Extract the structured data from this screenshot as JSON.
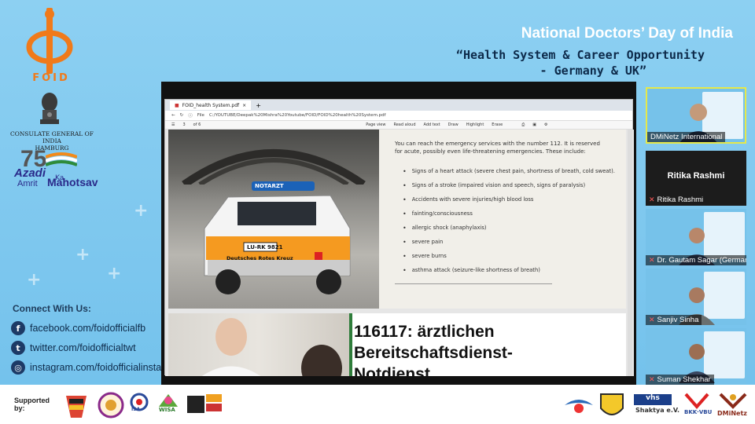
{
  "brand": {
    "foid_text": "FOID",
    "consulate_line1": "CONSULATE GENERAL OF INDIA",
    "consulate_line2": "HAMBURG",
    "azadi_num": "75",
    "azadi_word": "Azadi",
    "azadi_ka": "Ka",
    "azadi_amrit": "Amrit",
    "azadi_mahotsav": "Mahotsav"
  },
  "header": {
    "title": "National Doctors’ Day of India",
    "subtitle_line1": "“Health System & Career Opportunity",
    "subtitle_line2": "- Germany & UK”"
  },
  "connect": {
    "title": "Connect With Us:",
    "links": [
      {
        "icon": "facebook-icon",
        "text": "facebook.com/foidofficialfb"
      },
      {
        "icon": "twitter-icon",
        "text": "twitter.com/foidofficialtwt"
      },
      {
        "icon": "instagram-icon",
        "text": "instagram.com/foidofficialinsta"
      }
    ]
  },
  "browser": {
    "tab_label": "FOID_health System.pdf",
    "address": "C:/YOUTUBE/Deepak%20Mishra%20Youtube/FOID/FOID%20health%20System.pdf",
    "file_label": "File",
    "page_num": "3",
    "page_total": "of 6",
    "toolbar": [
      "Page view",
      "Read aloud",
      "Add text",
      "Draw",
      "Highlight",
      "Erase"
    ]
  },
  "pdf": {
    "ambulance_sign": "NOTARZT",
    "plate": "LU-RK 9821",
    "drk": "Deutsches Rotes Kreuz",
    "intro": "You can reach the emergency services with the number 112. It is reserved for acute, possibly even life-threatening emergencies. These include:",
    "items": [
      "Signs of a heart attack (severe chest pain, shortness of breath, cold sweat).",
      "Signs of a stroke (impaired vision and speech, signs of paralysis)",
      "Accidents with severe injuries/high blood loss",
      "fainting/consciousness",
      "allergic shock (anaphylaxis)",
      "severe pain",
      "severe burns",
      "asthma attack (seizure-like shortness of breath)"
    ],
    "page2_title_line1": "116117: ärztlichen",
    "page2_title_line2": "Bereitschaftsdienst-",
    "page2_title_line3": "Notdienst"
  },
  "gallery": {
    "tiles": [
      {
        "name": "DMiNetz International",
        "muted": false
      },
      {
        "name": "Ritika Rashmi",
        "muted": true
      },
      {
        "name": "Dr. Gautam Sagar (Germany)",
        "muted": true
      },
      {
        "name": "Sanjiv Sinha",
        "muted": true
      },
      {
        "name": "Suman Shekhar",
        "muted": true
      }
    ],
    "black_tile_name": "Ritika Rashmi"
  },
  "footer": {
    "supported_line1": "Supported",
    "supported_line2": "by:",
    "wisa": "WISA",
    "isa": "ISA",
    "vhs": "vhs",
    "shaktya": "Shaktya e.V.",
    "bkk": "BKK·VBU",
    "diminetz": "DMiNetz"
  },
  "colors": {
    "background": "#7ec8ee",
    "brand_orange": "#f07a1a",
    "header_white": "#ffffff",
    "navy": "#0d2a4a",
    "active_tile_border": "#e6e84a"
  }
}
